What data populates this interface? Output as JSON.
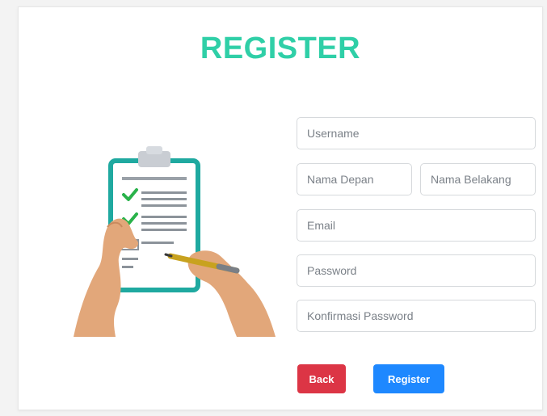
{
  "page": {
    "title": "REGISTER"
  },
  "form": {
    "username_placeholder": "Username",
    "first_name_placeholder": "Nama Depan",
    "last_name_placeholder": "Nama Belakang",
    "email_placeholder": "Email",
    "password_placeholder": "Password",
    "confirm_password_placeholder": "Konfirmasi Password"
  },
  "buttons": {
    "back_label": "Back",
    "register_label": "Register"
  },
  "colors": {
    "title": "#2fcfa7",
    "back_button": "#dc3545",
    "register_button": "#1e88ff",
    "clipboard_border": "#1fa9a0"
  },
  "illustration": {
    "icon": "clipboard-checklist-illustration"
  }
}
